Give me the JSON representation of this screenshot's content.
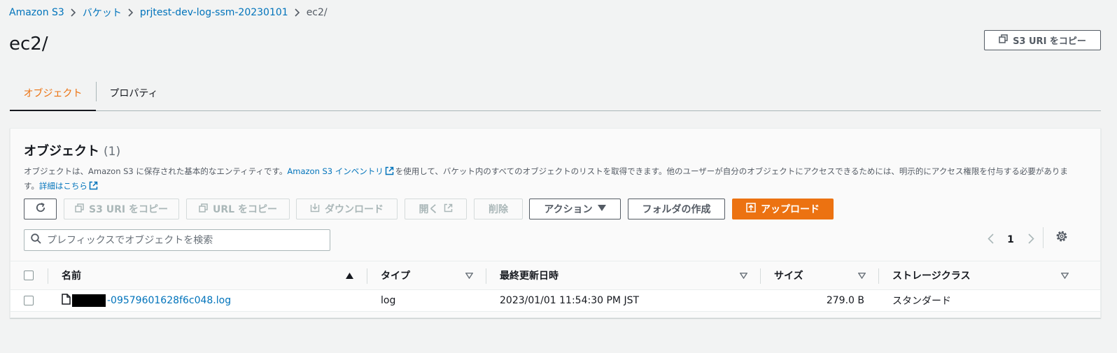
{
  "breadcrumb": {
    "items": [
      "Amazon S3",
      "バケット",
      "prjtest-dev-log-ssm-20230101"
    ],
    "current": "ec2/"
  },
  "page": {
    "title": "ec2/",
    "copy_uri_label": "S3 URI をコピー"
  },
  "tabs": {
    "objects": "オブジェクト",
    "properties": "プロパティ"
  },
  "panel": {
    "title": "オブジェクト",
    "count": "(1)",
    "desc_part1": "オブジェクトは、Amazon S3 に保存された基本的なエンティティです。",
    "desc_link1": "Amazon S3 インベントリ",
    "desc_part2": "を使用して、バケット内のすべてのオブジェクトのリストを取得できます。他のユーザーが自分のオブジェクトにアクセスできるためには、明示的にアクセス権限を付与する必要があります。",
    "desc_link2": "詳細はこちら"
  },
  "toolbar": {
    "copy_s3_uri": "S3 URI をコピー",
    "copy_url": "URL をコピー",
    "download": "ダウンロード",
    "open": "開く",
    "delete": "削除",
    "actions": "アクション",
    "create_folder": "フォルダの作成",
    "upload": "アップロード"
  },
  "search": {
    "placeholder": "プレフィックスでオブジェクトを検索"
  },
  "pagination": {
    "current_page": "1"
  },
  "table": {
    "columns": [
      "名前",
      "タイプ",
      "最終更新日時",
      "サイズ",
      "ストレージクラス"
    ],
    "rows": [
      {
        "name": "-09579601628f6c048.log",
        "type": "log",
        "modified": "2023/01/01 11:54:30 PM JST",
        "size": "279.0 B",
        "storage_class": "スタンダード"
      }
    ]
  },
  "colors": {
    "link": "#0073bb",
    "accent": "#ec7211",
    "text": "#16191f",
    "background": "#f2f3f3"
  },
  "icons": [
    "chevron-right-icon",
    "copy-icon",
    "refresh-icon",
    "download-icon",
    "external-link-icon",
    "caret-down-icon",
    "upload-icon",
    "search-icon",
    "chevron-left-icon",
    "gear-icon",
    "sort-asc-icon",
    "sort-icon",
    "file-icon"
  ]
}
